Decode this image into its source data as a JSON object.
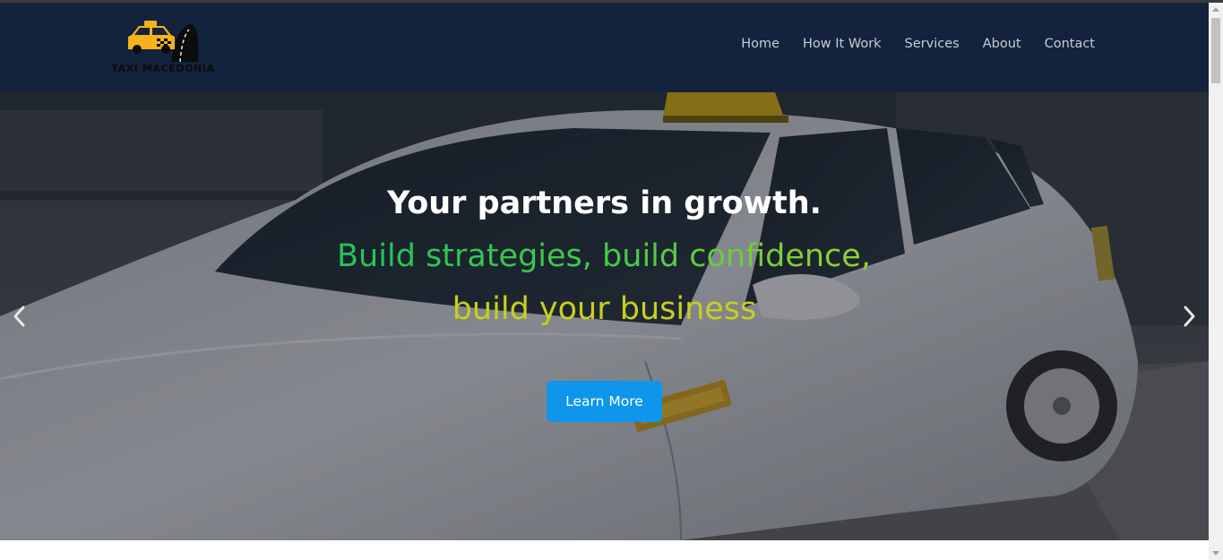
{
  "brand": {
    "logo_text": "TAXI MACEDONIA",
    "logo_icon": "taxi-car-road-icon",
    "colors": {
      "taxi_yellow": "#f5b21a",
      "nav_bg": "#13233d"
    }
  },
  "nav": {
    "items": [
      {
        "label": "Home"
      },
      {
        "label": "How It Work"
      },
      {
        "label": "Services"
      },
      {
        "label": "About"
      },
      {
        "label": "Contact"
      }
    ]
  },
  "hero": {
    "headline": "Your partners in growth.",
    "subline_1": "Build strategies, build confidence,",
    "subline_2": "build your business",
    "cta_label": "Learn More",
    "prev_icon": "chevron-left-icon",
    "next_icon": "chevron-right-icon",
    "background": "white-taxi-car-photo",
    "colors": {
      "cta": "#0d96ec",
      "subline_1_start": "#21c25a",
      "subline_1_end": "#9fd22c",
      "subline_2": "#c9cf1e"
    }
  }
}
